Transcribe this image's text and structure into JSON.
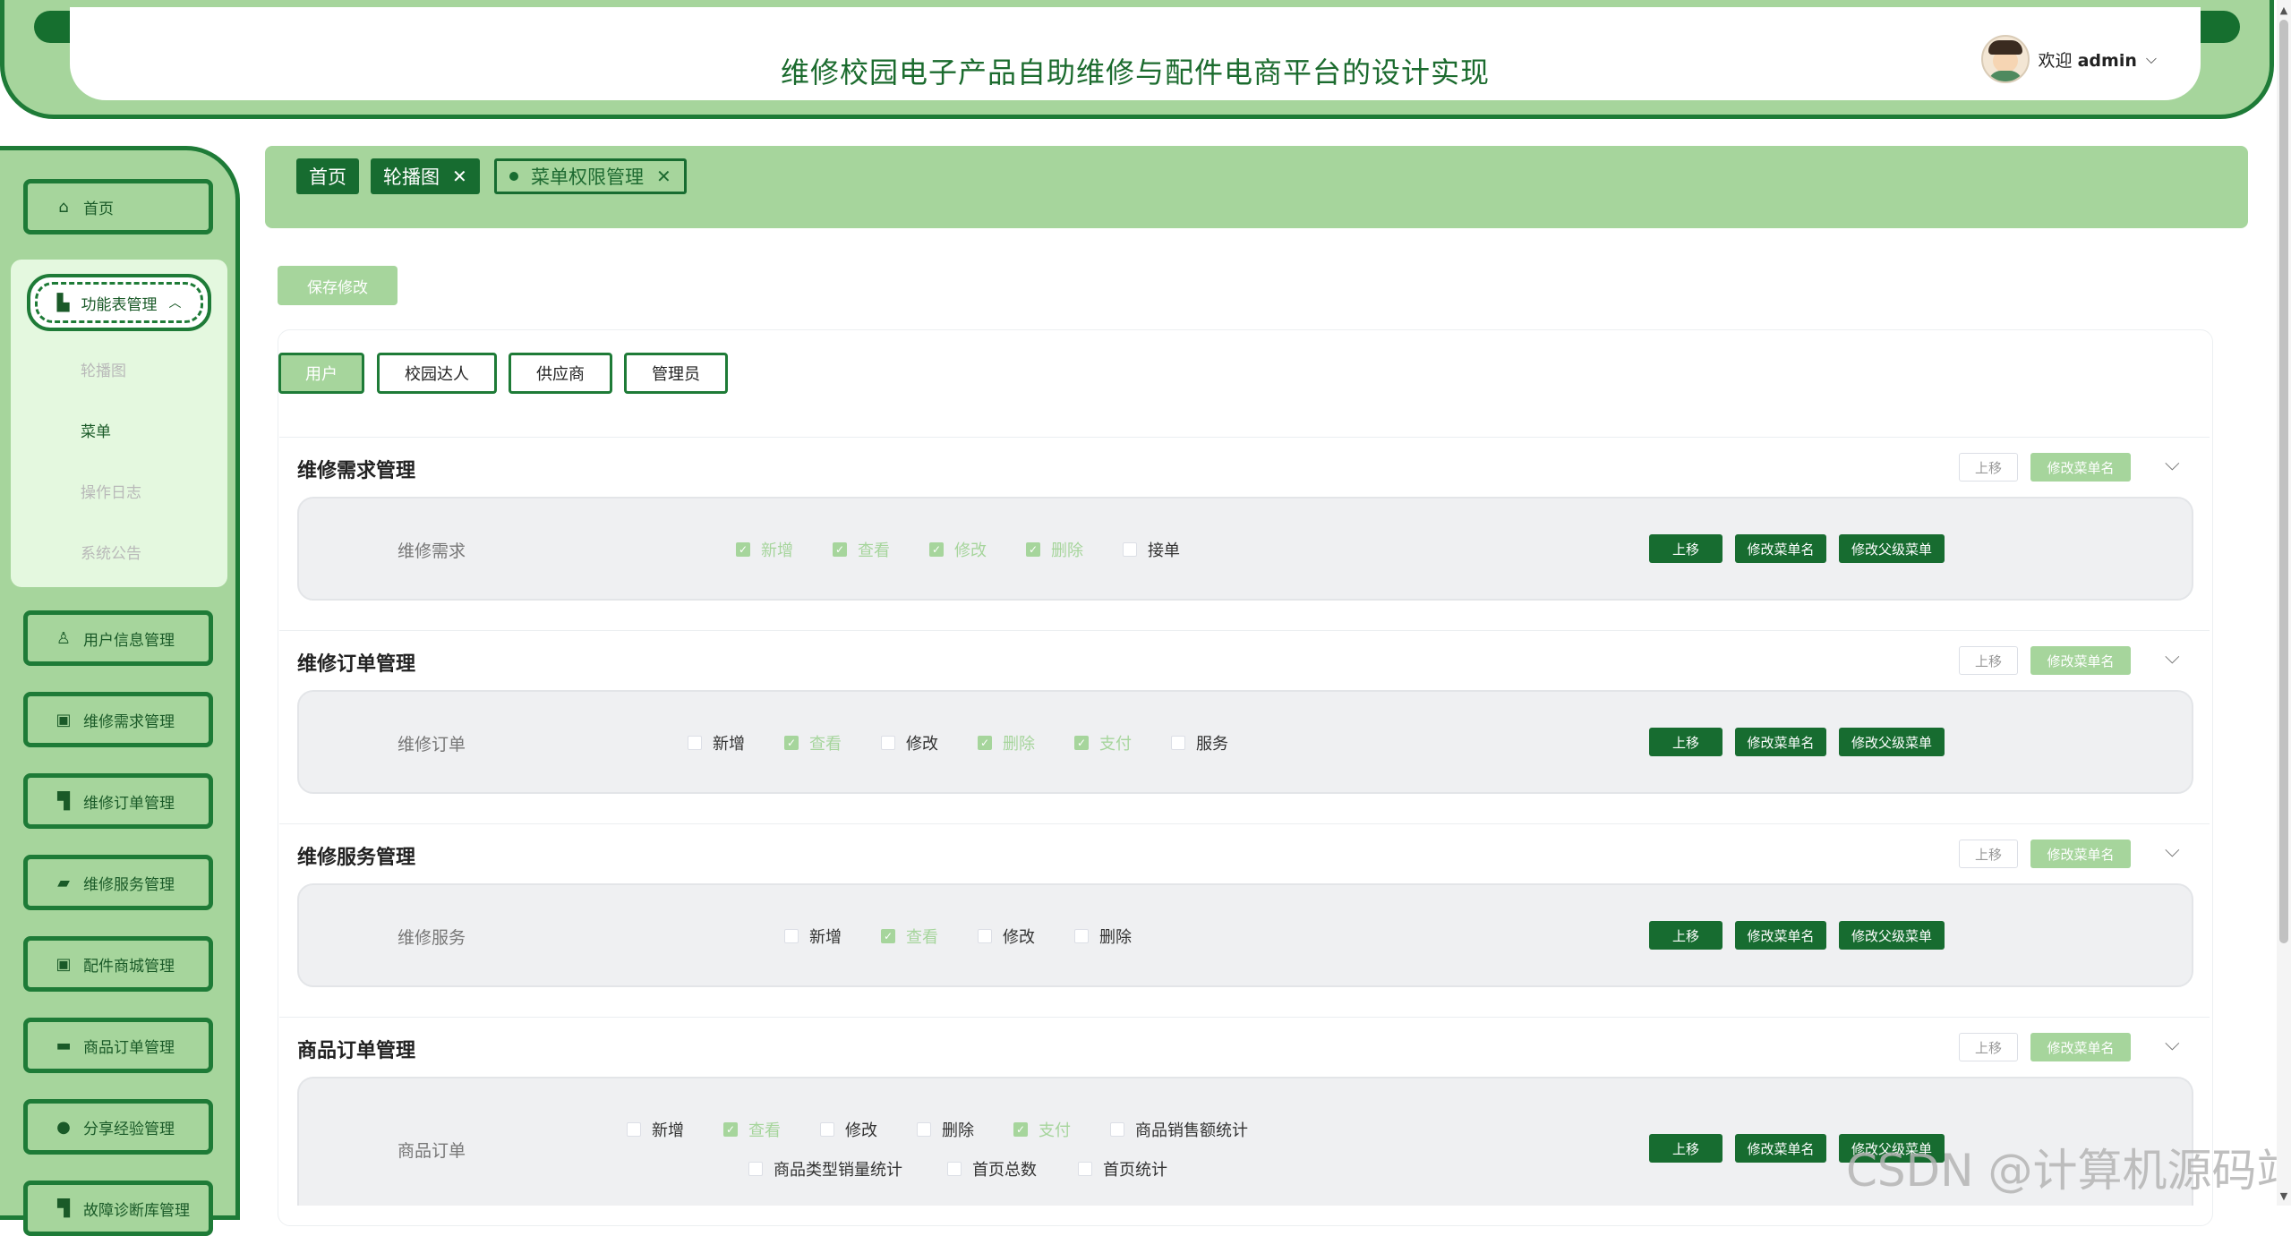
{
  "header": {
    "title": "维修校园电子产品自助维修与配件电商平台的设计实现",
    "welcome": "欢迎",
    "username": "admin"
  },
  "sidebar": {
    "home": "首页",
    "function_group": "功能表管理",
    "sub_items": [
      "轮播图",
      "菜单",
      "操作日志",
      "系统公告"
    ],
    "items": [
      "用户信息管理",
      "维修需求管理",
      "维修订单管理",
      "维修服务管理",
      "配件商城管理",
      "商品订单管理",
      "分享经验管理",
      "故障诊断库管理"
    ]
  },
  "tags": [
    "首页",
    "轮播图",
    "菜单权限管理"
  ],
  "toolbar": {
    "save": "保存修改"
  },
  "roles": [
    "用户",
    "校园达人",
    "供应商",
    "管理员"
  ],
  "labels": {
    "up": "上移",
    "rename": "修改菜单名",
    "rename_parent": "修改父级菜单"
  },
  "sections": [
    {
      "title": "维修需求管理",
      "item": "维修需求",
      "perms": [
        {
          "label": "新增",
          "checked": true
        },
        {
          "label": "查看",
          "checked": true
        },
        {
          "label": "修改",
          "checked": true
        },
        {
          "label": "删除",
          "checked": true
        },
        {
          "label": "接单",
          "checked": false
        }
      ]
    },
    {
      "title": "维修订单管理",
      "item": "维修订单",
      "perms": [
        {
          "label": "新增",
          "checked": false
        },
        {
          "label": "查看",
          "checked": true
        },
        {
          "label": "修改",
          "checked": false
        },
        {
          "label": "删除",
          "checked": true
        },
        {
          "label": "支付",
          "checked": true
        },
        {
          "label": "服务",
          "checked": false
        }
      ]
    },
    {
      "title": "维修服务管理",
      "item": "维修服务",
      "perms": [
        {
          "label": "新增",
          "checked": false
        },
        {
          "label": "查看",
          "checked": true
        },
        {
          "label": "修改",
          "checked": false
        },
        {
          "label": "删除",
          "checked": false
        }
      ]
    },
    {
      "title": "商品订单管理",
      "item": "商品订单",
      "perms": [
        {
          "label": "新增",
          "checked": false
        },
        {
          "label": "查看",
          "checked": true
        },
        {
          "label": "修改",
          "checked": false
        },
        {
          "label": "删除",
          "checked": false
        },
        {
          "label": "支付",
          "checked": true
        },
        {
          "label": "商品销售额统计",
          "checked": false
        },
        {
          "label": "商品类型销量统计",
          "checked": false
        },
        {
          "label": "首页总数",
          "checked": false
        },
        {
          "label": "首页统计",
          "checked": false
        }
      ]
    }
  ],
  "watermark": "CSDN @计算机源码站",
  "colors": {
    "primary": "#176c30",
    "light": "#a6d59c",
    "pale": "#e4f8df"
  }
}
